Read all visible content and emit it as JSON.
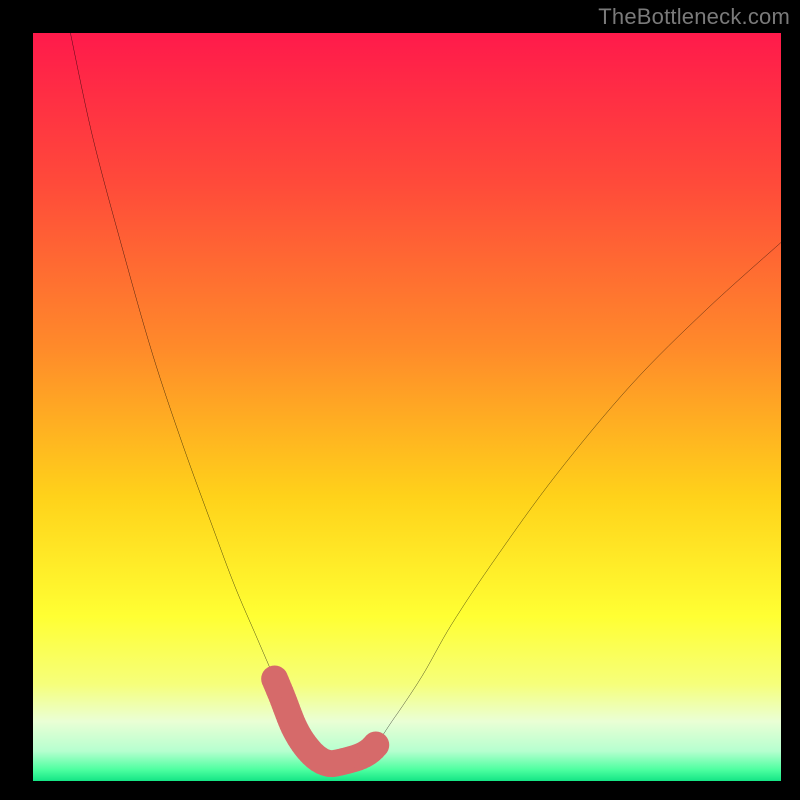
{
  "watermark": "TheBottleneck.com",
  "chart_data": {
    "type": "line",
    "title": "",
    "xlabel": "",
    "ylabel": "",
    "xlim": [
      0,
      100
    ],
    "ylim": [
      0,
      100
    ],
    "gradient_stops": [
      {
        "offset": 0.0,
        "color": "#ff1a4b"
      },
      {
        "offset": 0.2,
        "color": "#ff4a3a"
      },
      {
        "offset": 0.42,
        "color": "#ff8a2a"
      },
      {
        "offset": 0.62,
        "color": "#ffd21a"
      },
      {
        "offset": 0.78,
        "color": "#ffff33"
      },
      {
        "offset": 0.87,
        "color": "#f6ff7a"
      },
      {
        "offset": 0.92,
        "color": "#eaffd5"
      },
      {
        "offset": 0.96,
        "color": "#b6ffcf"
      },
      {
        "offset": 0.985,
        "color": "#4dffa0"
      },
      {
        "offset": 1.0,
        "color": "#15e585"
      }
    ],
    "series": [
      {
        "name": "bottleneck-curve",
        "x": [
          5,
          8,
          12,
          16,
          20,
          24,
          27,
          30,
          33,
          35,
          37,
          39,
          41,
          45,
          48,
          52,
          56,
          62,
          70,
          80,
          90,
          100
        ],
        "y": [
          100,
          86,
          71,
          57,
          45,
          34,
          26,
          19,
          12,
          7,
          4,
          2.5,
          2.5,
          4,
          8,
          14,
          21,
          30,
          41,
          53,
          63,
          72
        ]
      }
    ],
    "trough_markers": {
      "xrange": [
        31,
        46
      ],
      "color": "#d66a6a",
      "radius": 1.8
    }
  }
}
